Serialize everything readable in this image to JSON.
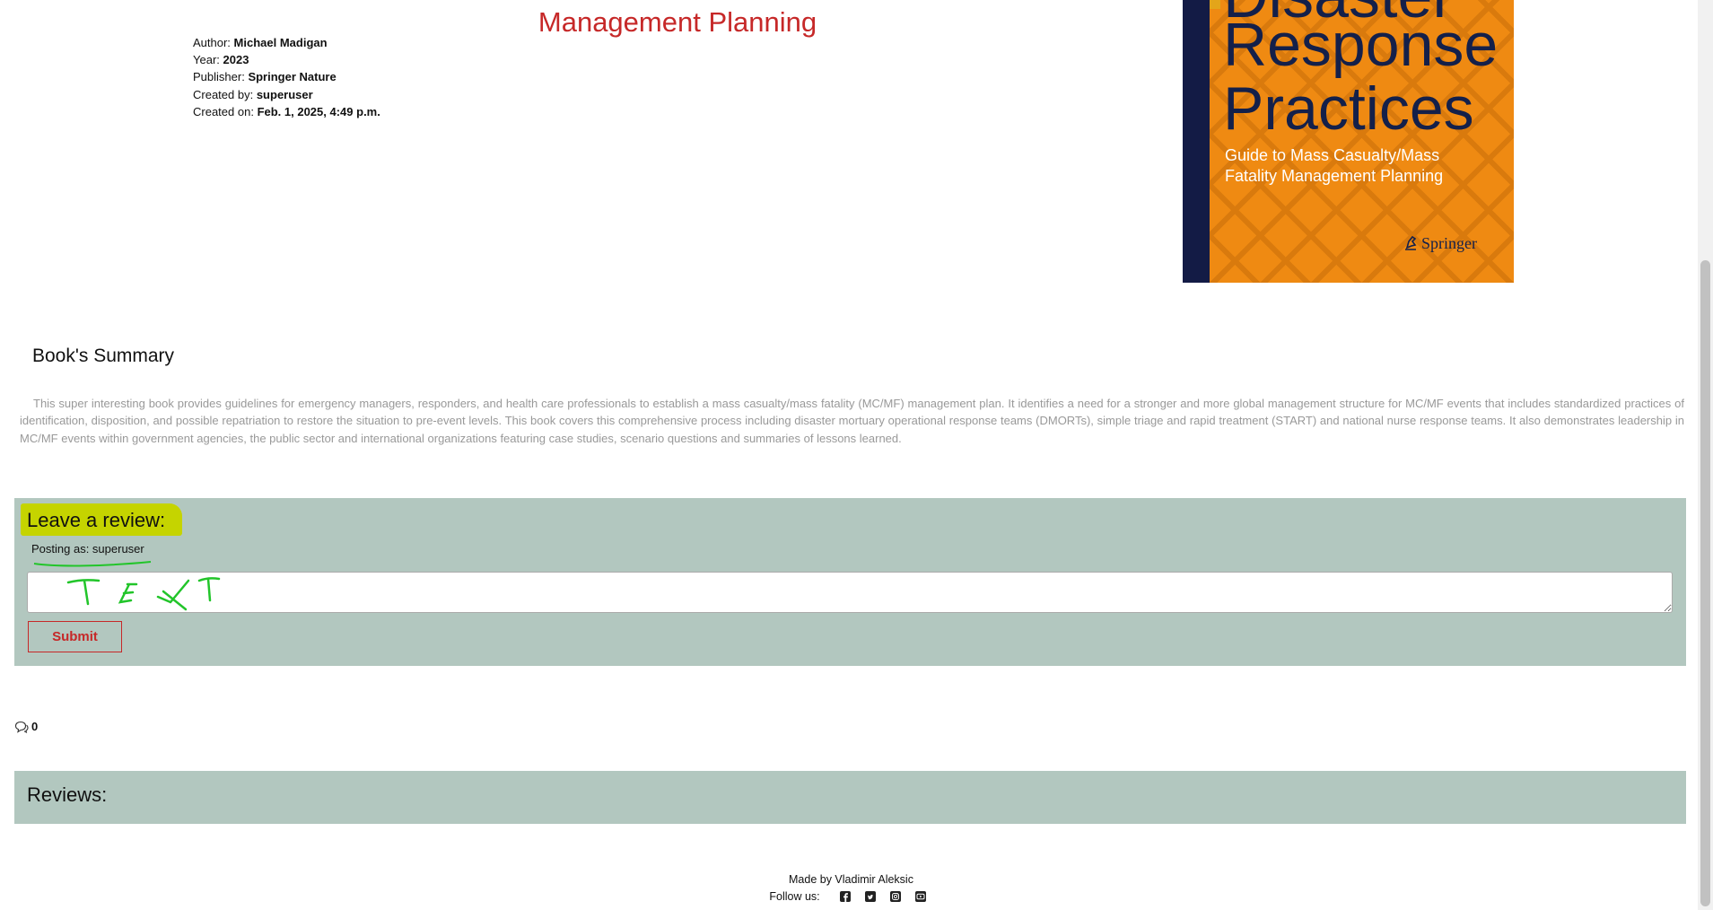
{
  "book": {
    "title_visible": "Management Planning",
    "meta": [
      {
        "label": "Author:",
        "value": "Michael Madigan"
      },
      {
        "label": "Year:",
        "value": "2023"
      },
      {
        "label": "Publisher:",
        "value": "Springer Nature"
      },
      {
        "label": "Created by:",
        "value": "superuser"
      },
      {
        "label": "Created on:",
        "value": "Feb. 1, 2025, 4:49 p.m."
      }
    ],
    "cover": {
      "title_lines": [
        "Disaster",
        "Response",
        "Practices"
      ],
      "subtitle": "Guide to Mass Casualty/Mass Fatality Management Planning",
      "publisher": "Springer"
    }
  },
  "summary": {
    "heading": "Book's Summary",
    "text": "This super interesting book provides guidelines for emergency managers, responders, and health care professionals to establish a mass casualty/mass fatality (MC/MF) management plan. It identifies a need for a stronger and more global management structure for MC/MF events that includes standardized practices of identification, disposition, and possible repatriation to restore the situation to pre-event levels. This book covers this comprehensive process including disaster mortuary operational response teams (DMORTs), simple triage and rapid treatment (START) and national nurse response teams. It also demonstrates leadership in MC/MF events within government agencies, the public sector and international organizations featuring case studies, scenario questions and summaries of lessons learned."
  },
  "review_form": {
    "heading": "Leave a review:",
    "posting_as": "Posting as: superuser",
    "textarea_value": "",
    "submit_label": "Submit"
  },
  "comments": {
    "count": "0",
    "icon": "comments-icon"
  },
  "reviews": {
    "heading": "Reviews:"
  },
  "footer": {
    "made_by": "Made by Vladimir Aleksic",
    "follow_label": "Follow us:",
    "social_icons": [
      "facebook-icon",
      "twitter-icon",
      "instagram-icon",
      "youtube-icon"
    ]
  },
  "colors": {
    "accent_red": "#c62828",
    "panel_bg": "#b2c7bf",
    "highlight": "#c5d400",
    "annotation_green": "#22c52a"
  }
}
